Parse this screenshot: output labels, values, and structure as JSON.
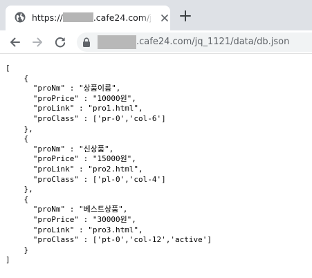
{
  "tab": {
    "title_prefix": "https://",
    "title_suffix": ".cafe24.com/jq_1",
    "favicon": "globe-icon",
    "close_icon": "close-icon"
  },
  "new_tab": {
    "icon": "plus-icon"
  },
  "toolbar": {
    "back_icon": "arrow-left-icon",
    "forward_icon": "arrow-right-icon",
    "reload_icon": "reload-icon",
    "lock_icon": "lock-icon"
  },
  "address_bar": {
    "url_visible": ".cafe24.com/jq_1121/data/db.json"
  },
  "json_text": "[\n    {\n      \"proNm\" : \"상품이름\",\n      \"proPrice\" : \"10000원\",\n      \"proLink\" : \"pro1.html\",\n      \"proClass\" : ['pr-0','col-6']\n    },\n    {\n      \"proNm\" : \"신상품\",\n      \"proPrice\" : \"15000원\",\n      \"proLink\" : \"pro2.html\",\n      \"proClass\" : ['pl-0','col-4']\n    },\n    {\n      \"proNm\" : \"베스트상품\",\n      \"proPrice\" : \"30000원\",\n      \"proLink\" : \"pro3.html\",\n      \"proClass\" : ['pt-0','col-12','active']\n    }\n]",
  "colors": {
    "tabstrip_bg": "#dee1e6",
    "omnibox_bg": "#f1f3f4",
    "icon_gray": "#5f6368",
    "redaction_gray": "#b8b8b8"
  }
}
